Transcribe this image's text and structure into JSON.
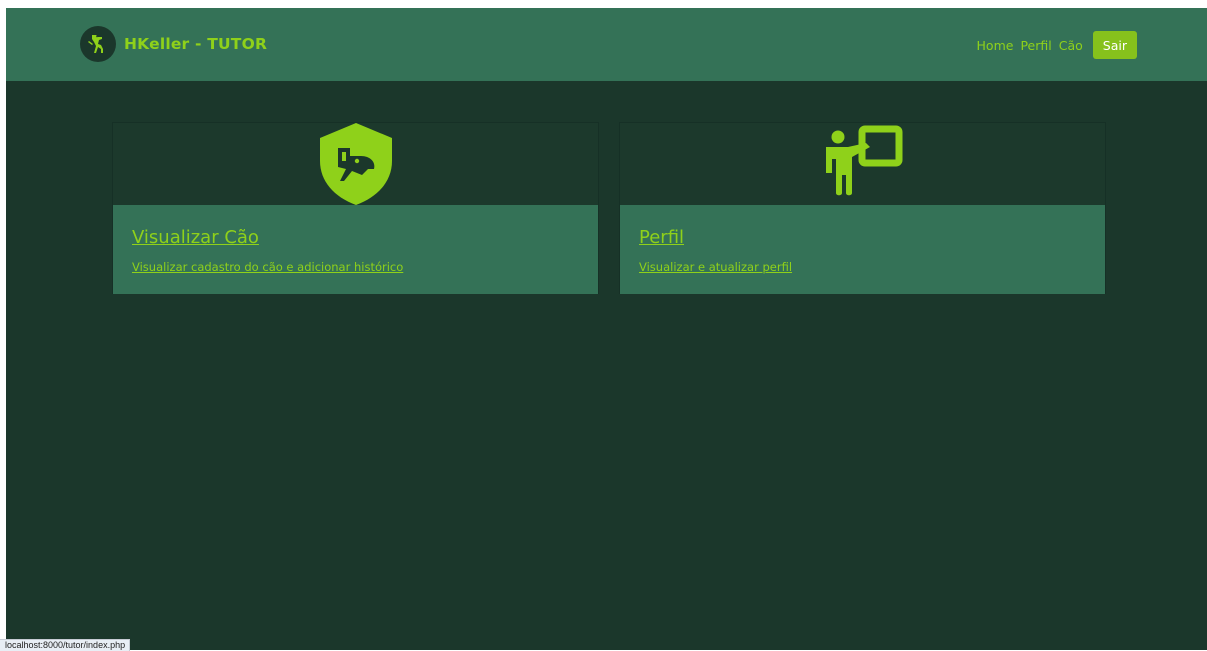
{
  "navbar": {
    "brand": "HKeller - TUTOR",
    "links": [
      "Home",
      "Perfil",
      "Cão"
    ],
    "logout_label": "Sair"
  },
  "cards": [
    {
      "title": "Visualizar Cão",
      "description": "Visualizar cadastro do cão e adicionar histórico",
      "icon": "dog-shield-icon"
    },
    {
      "title": "Perfil",
      "description": "Visualizar e atualizar perfil",
      "icon": "presenter-board-icon"
    }
  ],
  "status_url": "localhost:8000/tutor/index.php",
  "colors": {
    "background": "#1b372b",
    "panel": "#347257",
    "accent": "#8fd11a",
    "button": "#86c11c"
  }
}
